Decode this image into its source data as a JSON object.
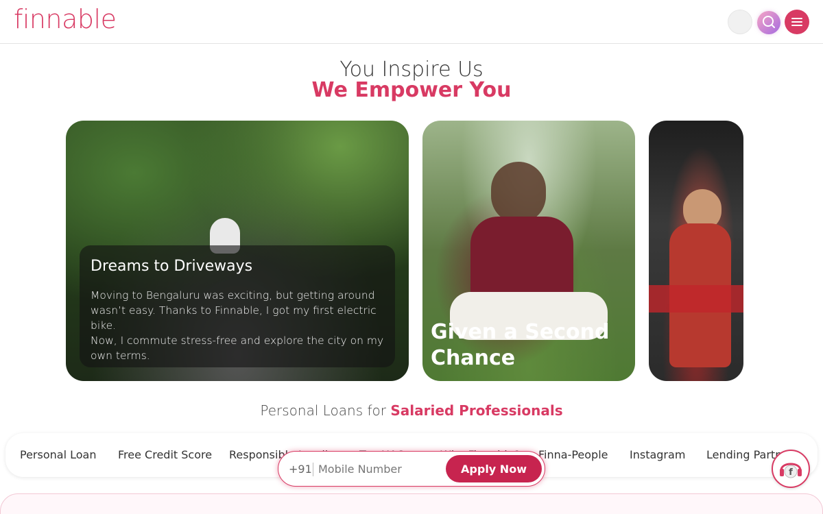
{
  "header": {
    "logo_text": "finnable",
    "icons": {
      "search": "search-icon",
      "menu": "hamburger-menu-icon"
    },
    "brand_color": "#d83a63"
  },
  "hero": {
    "line1": "You Inspire Us",
    "line2": "We Empower You"
  },
  "cards": [
    {
      "title": "Dreams to Driveways",
      "text": "Moving to Bengaluru was exciting, but getting around wasn’t easy. Thanks to Finnable, I got my first electric bike.\nNow, I commute stress-free and explore the city on my own terms."
    },
    {
      "title": "Given a Second Chance"
    },
    {
      "title": ""
    }
  ],
  "personal_loans": {
    "prefix": "Personal Loans for",
    "highlight": "Salaried Professionals"
  },
  "nav": {
    "items": [
      "Personal Loan",
      "Free Credit Score",
      "Responsible Lending",
      "Top UAQs",
      "Why Finnable?",
      "Finna-People",
      "Instagram",
      "Lending Partners"
    ]
  },
  "apply": {
    "country_code": "+91",
    "placeholder": "Mobile Number",
    "button_label": "Apply Now",
    "button_color": "#c7244f"
  },
  "support": {
    "icon": "support-headset-icon",
    "badge_letter": "f"
  }
}
